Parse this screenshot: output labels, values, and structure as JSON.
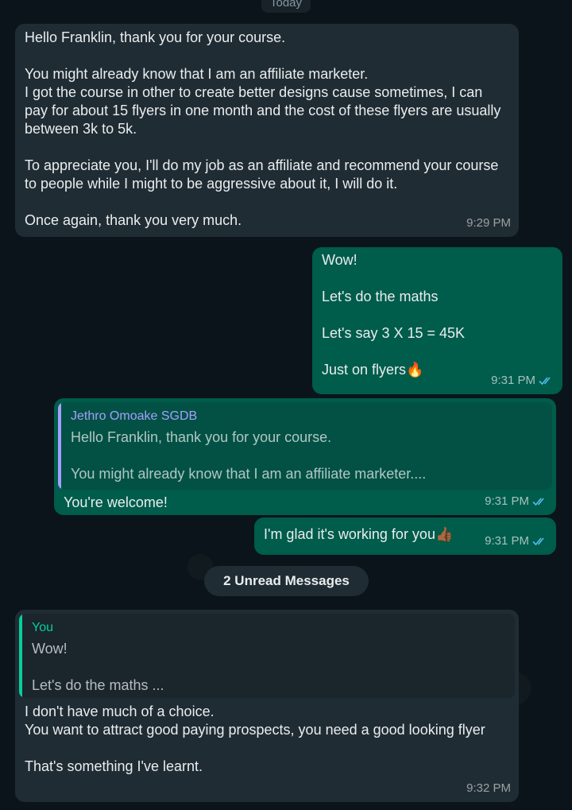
{
  "day_separator": "Today",
  "messages": [
    {
      "direction": "in",
      "text": "Hello Franklin, thank you for your course.\n\nYou might already know that I am an affiliate marketer.\nI got the course in other to create better designs cause sometimes, I can pay for about 15 flyers in one month and the cost of these flyers are usually between 3k to 5k.\n\nTo appreciate you, I'll do my job as an affiliate and recommend your course to people while I might to be aggressive about it, I will do it.\n\nOnce again, thank you very much.",
      "time": "9:29 PM"
    },
    {
      "direction": "out",
      "text": "Wow!\n\nLet's do the maths\n\nLet's say 3 X 15 = 45K\n\nJust on flyers",
      "emoji": "🔥",
      "time": "9:31 PM",
      "status": "read"
    },
    {
      "direction": "out",
      "quote": {
        "author": "Jethro Omoake SGDB",
        "text": "Hello Franklin, thank you for your course.\n\nYou might already know that I am an affiliate marketer...."
      },
      "text": "You're welcome!",
      "time": "9:31 PM",
      "status": "read"
    },
    {
      "direction": "out",
      "text": "I'm glad it's working for you",
      "emoji": "👍🏾",
      "time": "9:31 PM",
      "status": "read"
    },
    {
      "direction": "in",
      "quote": {
        "author": "You",
        "text": "Wow!\n\nLet's do the maths ..."
      },
      "text": "I don't have much of a choice.\nYou want to attract good paying prospects, you need a good looking flyer\n\nThat's something I've learnt.",
      "time": "9:32 PM"
    }
  ],
  "unread_chip": "2 Unread Messages",
  "colors": {
    "background": "#0b141a",
    "incoming_bubble": "#202c33",
    "outgoing_bubble": "#005c4b",
    "read_ticks": "#53bdeb",
    "quote_you": "#06cf9c",
    "quote_contact": "#a5a0ff"
  }
}
